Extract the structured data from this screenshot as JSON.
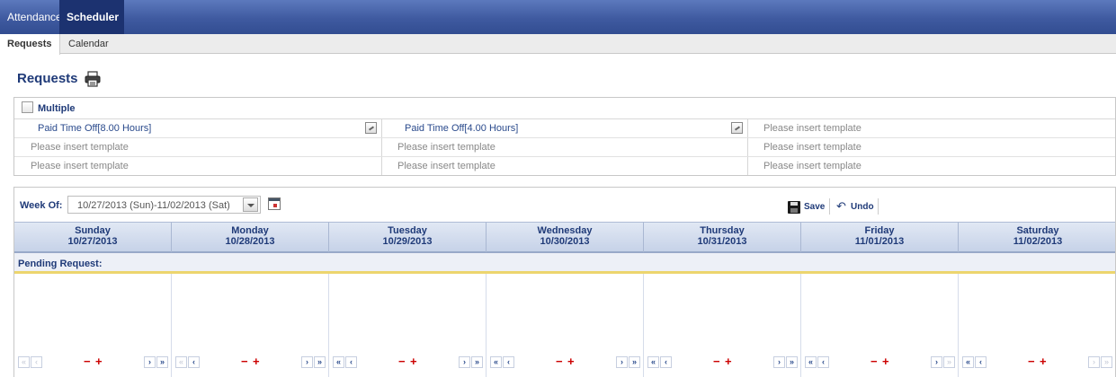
{
  "nav": {
    "tabs": [
      "Attendance",
      "Scheduler"
    ],
    "active": "Scheduler"
  },
  "subnav": {
    "tabs": [
      "Requests",
      "Calendar"
    ],
    "active": "Requests"
  },
  "page": {
    "title": "Requests"
  },
  "templates": {
    "multiple_label": "Multiple",
    "rows": [
      [
        "Paid Time Off[8.00 Hours]",
        "Paid Time Off[4.00 Hours]",
        "Please insert template"
      ],
      [
        "Please insert template",
        "Please insert template",
        "Please insert template"
      ],
      [
        "Please insert template",
        "Please insert template",
        "Please insert template"
      ]
    ]
  },
  "toolbar": {
    "week_of_label": "Week Of:",
    "week_value": "10/27/2013 (Sun)-11/02/2013 (Sat)",
    "save_label": "Save",
    "undo_label": "Undo"
  },
  "days": [
    {
      "name": "Sunday",
      "date": "10/27/2013"
    },
    {
      "name": "Monday",
      "date": "10/28/2013"
    },
    {
      "name": "Tuesday",
      "date": "10/29/2013"
    },
    {
      "name": "Wednesday",
      "date": "10/30/2013"
    },
    {
      "name": "Thursday",
      "date": "10/31/2013"
    },
    {
      "name": "Friday",
      "date": "11/01/2013"
    },
    {
      "name": "Saturday",
      "date": "11/02/2013"
    }
  ],
  "pending_label": "Pending Request:",
  "day_controls": {
    "first": "«",
    "prev": "‹",
    "minus": "−",
    "plus": "+",
    "next": "›",
    "last": "»"
  },
  "colors": {
    "nav_bg": "#3f5aa0",
    "nav_active": "#1c3270",
    "accent": "#1f3a78",
    "pending_border": "#ecd56e",
    "plusminus": "#cc0000"
  }
}
